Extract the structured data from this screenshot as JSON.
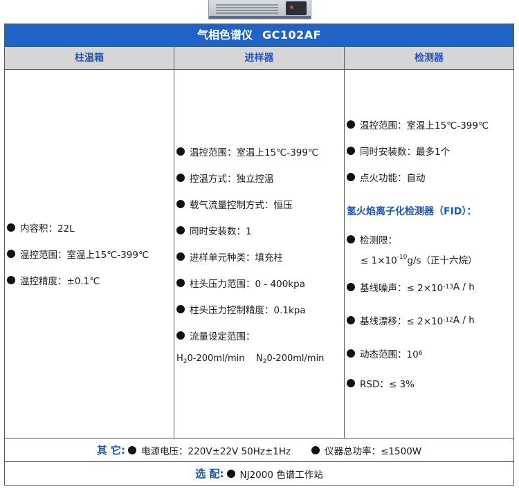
{
  "title": {
    "name": "气相色谱仪",
    "model": "GC102AF"
  },
  "columns": {
    "oven": {
      "header": "柱温箱",
      "items": [
        "内容积：22L",
        "温控范围：室温上15℃-399℃",
        "温控精度：±0.1℃"
      ]
    },
    "injector": {
      "header": "进样器",
      "items": [
        "温控范围：室温上15℃-399℃",
        "控温方式：独立控温",
        "载气流量控制方式：恒压",
        "同时安装数：1",
        "进样单元种类：填充柱",
        "柱头压力范围：0 - 400kpa",
        "柱头压力控制精度：0.1kpa",
        "流量设定范围："
      ],
      "flow_h2_prefix": "H",
      "flow_h2_sub": "2",
      "flow_h2_rest": "0-200ml/min",
      "flow_n2_prefix": "N",
      "flow_n2_sub": "2",
      "flow_n2_rest": "0-200ml/min"
    },
    "detector": {
      "header": "检测器",
      "items": [
        "温控范围：室温上15℃-399℃",
        "同时安装数：最多1个",
        "点火功能：自动"
      ],
      "fid_title": "氢火焰离子化检测器（FID）：",
      "limit_label": "检测限：",
      "limit_pre": "≤ 1×10",
      "limit_exp": "-10",
      "limit_post": "g/s（正十六烷）",
      "noise_pre": "基线噪声：≤ 2×10",
      "noise_exp": "-13",
      "noise_post": " A / h",
      "drift_pre": "基线漂移：≤ 2×10",
      "drift_exp": "-12",
      "drift_post": " A / h",
      "range_pre": "动态范围：10",
      "range_exp": "6",
      "rsd": "RSD：≤ 3%"
    }
  },
  "other": {
    "label": "其 它:",
    "power": "电源电压：220V±22V 50Hz±1Hz",
    "total_power": "仪器总功率：≤1500W"
  },
  "optional": {
    "label": "选 配:",
    "item": "NJ2000 色谱工作站"
  },
  "colors": {
    "title_bg": "#1f63c9",
    "header_bg": "#d6d6d6",
    "accent_text": "#1f55c0"
  }
}
